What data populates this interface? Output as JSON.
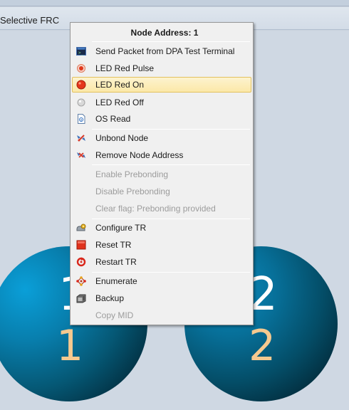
{
  "header": {
    "title": "Selective FRC"
  },
  "nodes": [
    {
      "top_label": "1",
      "bottom_label": "1"
    },
    {
      "top_label": "2",
      "bottom_label": "2"
    }
  ],
  "menu": {
    "header": "Node Address: 1",
    "items": [
      {
        "label": "Send Packet from DPA Test Terminal",
        "icon": "terminal-icon",
        "enabled": true
      },
      {
        "label": "LED Red Pulse",
        "icon": "led-pulse-icon",
        "enabled": true
      },
      {
        "label": "LED Red On",
        "icon": "led-red-on-icon",
        "enabled": true,
        "highlighted": true
      },
      {
        "label": "LED Red Off",
        "icon": "led-off-icon",
        "enabled": true
      },
      {
        "label": "OS Read",
        "icon": "os-read-icon",
        "enabled": true
      },
      {
        "label": "Unbond Node",
        "icon": "unbond-icon",
        "enabled": true
      },
      {
        "label": "Remove Node Address",
        "icon": "remove-address-icon",
        "enabled": true
      },
      {
        "label": "Enable Prebonding",
        "icon": "",
        "enabled": false
      },
      {
        "label": "Disable Prebonding",
        "icon": "",
        "enabled": false
      },
      {
        "label": "Clear flag: Prebonding provided",
        "icon": "",
        "enabled": false
      },
      {
        "label": "Configure TR",
        "icon": "configure-icon",
        "enabled": true
      },
      {
        "label": "Reset TR",
        "icon": "reset-icon",
        "enabled": true
      },
      {
        "label": "Restart TR",
        "icon": "restart-icon",
        "enabled": true
      },
      {
        "label": "Enumerate",
        "icon": "enumerate-icon",
        "enabled": true
      },
      {
        "label": "Backup",
        "icon": "backup-icon",
        "enabled": true
      },
      {
        "label": "Copy MID",
        "icon": "",
        "enabled": false
      }
    ]
  },
  "colors": {
    "highlight": "#fbe8a8",
    "node_dark": "#022a3a",
    "node_light": "#0a9fd8",
    "node_label_bottom": "#f6c98f"
  }
}
